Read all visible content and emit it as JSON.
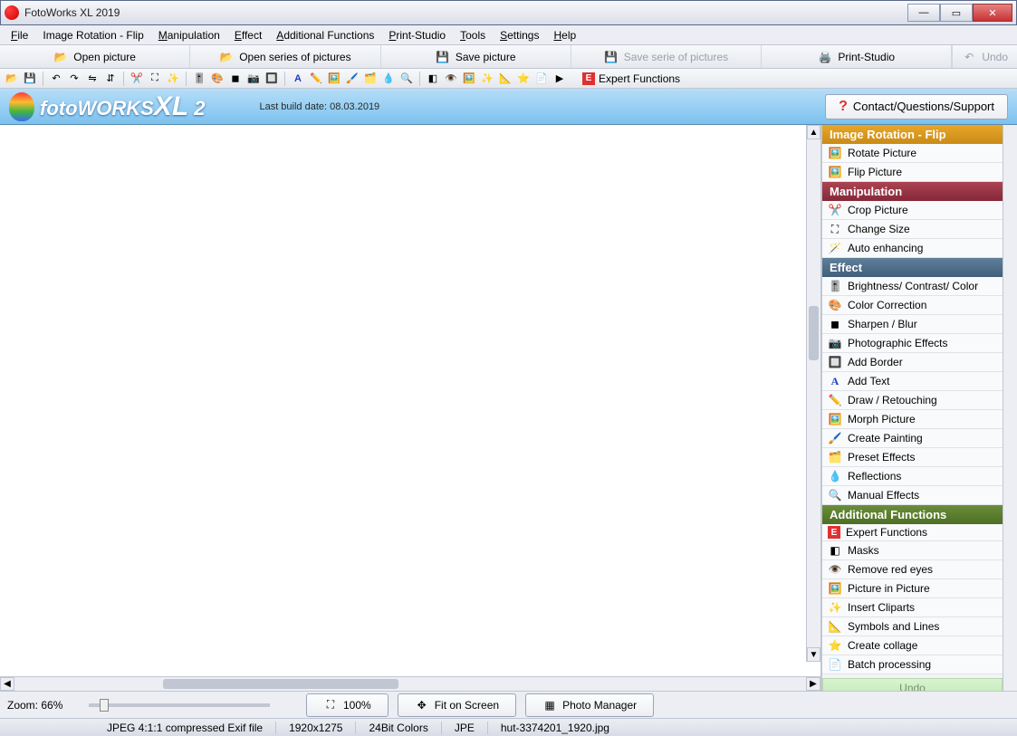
{
  "window": {
    "title": "FotoWorks XL 2019"
  },
  "menu": {
    "file": "File",
    "image_rotation": "Image Rotation - Flip",
    "manipulation": "Manipulation",
    "effect": "Effect",
    "additional": "Additional Functions",
    "print_studio": "Print-Studio",
    "tools": "Tools",
    "settings": "Settings",
    "help": "Help"
  },
  "toolbar": {
    "open_picture": "Open picture",
    "open_series": "Open series of pictures",
    "save_picture": "Save picture",
    "save_series": "Save serie of pictures",
    "print_studio": "Print-Studio",
    "undo": "Undo"
  },
  "icon_toolbar": {
    "expert_functions": "Expert Functions"
  },
  "banner": {
    "logo1": "foto",
    "logo2": "WORKS",
    "logo3": "XL",
    "logo4": "2",
    "build": "Last build date: 08.03.2019",
    "contact": "Contact/Questions/Support"
  },
  "side": {
    "headers": {
      "rotation": "Image Rotation - Flip",
      "manipulation": "Manipulation",
      "effect": "Effect",
      "additional": "Additional Functions"
    },
    "rotation": [
      {
        "icon": "🖼️",
        "label": "Rotate Picture"
      },
      {
        "icon": "🖼️",
        "label": "Flip Picture"
      }
    ],
    "manipulation": [
      {
        "icon": "✂️",
        "label": "Crop Picture"
      },
      {
        "icon": "⛶",
        "label": "Change Size"
      },
      {
        "icon": "🪄",
        "label": "Auto enhancing"
      }
    ],
    "effect": [
      {
        "icon": "🎚️",
        "label": "Brightness/ Contrast/ Color"
      },
      {
        "icon": "🎨",
        "label": "Color Correction"
      },
      {
        "icon": "◼",
        "label": "Sharpen / Blur"
      },
      {
        "icon": "📷",
        "label": "Photographic Effects"
      },
      {
        "icon": "🔲",
        "label": "Add Border"
      },
      {
        "icon": "A",
        "label": "Add Text"
      },
      {
        "icon": "✏️",
        "label": "Draw / Retouching"
      },
      {
        "icon": "🖼️",
        "label": "Morph Picture"
      },
      {
        "icon": "🖌️",
        "label": "Create Painting"
      },
      {
        "icon": "🗂️",
        "label": "Preset Effects"
      },
      {
        "icon": "💧",
        "label": "Reflections"
      },
      {
        "icon": "🔍",
        "label": "Manual Effects"
      }
    ],
    "additional": [
      {
        "icon": "E",
        "label": "Expert Functions"
      },
      {
        "icon": "◧",
        "label": "Masks"
      },
      {
        "icon": "👁️",
        "label": "Remove red eyes"
      },
      {
        "icon": "🖼️",
        "label": "Picture in Picture"
      },
      {
        "icon": "✨",
        "label": "Insert Cliparts"
      },
      {
        "icon": "📐",
        "label": "Symbols and Lines"
      },
      {
        "icon": "⭐",
        "label": "Create collage"
      },
      {
        "icon": "📄",
        "label": "Batch processing"
      }
    ],
    "undo": "Undo"
  },
  "zoom": {
    "label": "Zoom: 66%",
    "btn_100": "100%",
    "btn_fit": "Fit on Screen",
    "btn_manager": "Photo Manager"
  },
  "status": {
    "format": "JPEG 4:1:1 compressed Exif file",
    "dimensions": "1920x1275",
    "depth": "24Bit Colors",
    "type": "JPE",
    "filename": "hut-3374201_1920.jpg"
  }
}
